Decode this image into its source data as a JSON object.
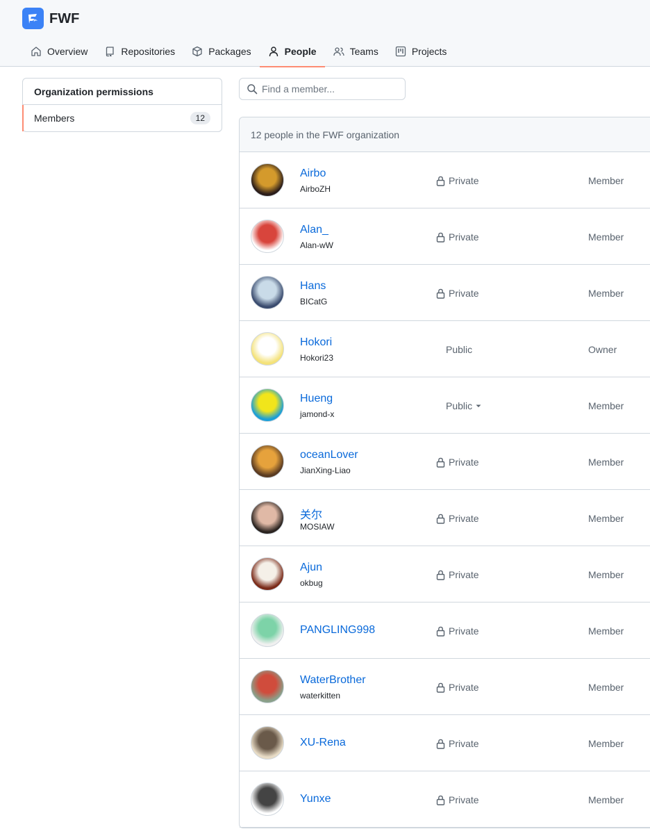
{
  "org": {
    "name": "FWF",
    "logo_icon": "org-logo",
    "accent": "#fd8c73",
    "link_color": "#0969da"
  },
  "nav": [
    {
      "label": "Overview",
      "icon": "home-icon",
      "active": false
    },
    {
      "label": "Repositories",
      "icon": "repo-icon",
      "active": false
    },
    {
      "label": "Packages",
      "icon": "package-icon",
      "active": false
    },
    {
      "label": "People",
      "icon": "person-icon",
      "active": true
    },
    {
      "label": "Teams",
      "icon": "people-icon",
      "active": false
    },
    {
      "label": "Projects",
      "icon": "project-icon",
      "active": false
    }
  ],
  "sidebar": {
    "heading": "Organization permissions",
    "items": [
      {
        "label": "Members",
        "count": "12"
      }
    ]
  },
  "search": {
    "placeholder": "Find a member..."
  },
  "members_header": "12 people in the FWF organization",
  "members": [
    {
      "name": "Airbo",
      "login": "AirboZH",
      "visibility": "Private",
      "role": "Member",
      "avatar_colors": [
        "#2b1d1a",
        "#d49a2c"
      ]
    },
    {
      "name": "Alan_",
      "login": "Alan-wW",
      "visibility": "Private",
      "role": "Member",
      "avatar_colors": [
        "#ffffff",
        "#d8453c"
      ]
    },
    {
      "name": "Hans",
      "login": "BICatG",
      "visibility": "Private",
      "role": "Member",
      "avatar_colors": [
        "#3a4b6e",
        "#c9dbe8"
      ]
    },
    {
      "name": "Hokori",
      "login": "Hokori23",
      "visibility": "Public",
      "role": "Owner",
      "avatar_colors": [
        "#f4e27a",
        "#ffffff"
      ]
    },
    {
      "name": "Hueng",
      "login": "jamond-x",
      "visibility": "Public",
      "role": "Member",
      "avatar_colors": [
        "#1a9fd8",
        "#f1e51b"
      ]
    },
    {
      "name": "oceanLover",
      "login": "JianXing-Liao",
      "visibility": "Private",
      "role": "Member",
      "avatar_colors": [
        "#5a3b22",
        "#e6a23c"
      ]
    },
    {
      "name": "关尔",
      "login": "MOSIAW",
      "visibility": "Private",
      "role": "Member",
      "avatar_colors": [
        "#2b2420",
        "#e0b9a6"
      ]
    },
    {
      "name": "Ajun",
      "login": "okbug",
      "visibility": "Private",
      "role": "Member",
      "avatar_colors": [
        "#7a2a18",
        "#f5f0e8"
      ]
    },
    {
      "name": "PANGLING998",
      "login": "",
      "visibility": "Private",
      "role": "Member",
      "avatar_colors": [
        "#f0f0f0",
        "#7dd3a8"
      ]
    },
    {
      "name": "WaterBrother",
      "login": "waterkitten",
      "visibility": "Private",
      "role": "Member",
      "avatar_colors": [
        "#8aa08a",
        "#d04c3c"
      ]
    },
    {
      "name": "XU-Rena",
      "login": "",
      "visibility": "Private",
      "role": "Member",
      "avatar_colors": [
        "#e8dcc6",
        "#6a5a4a"
      ]
    },
    {
      "name": "Yunxe",
      "login": "",
      "visibility": "Private",
      "role": "Member",
      "avatar_colors": [
        "#ffffff",
        "#444444"
      ]
    }
  ]
}
